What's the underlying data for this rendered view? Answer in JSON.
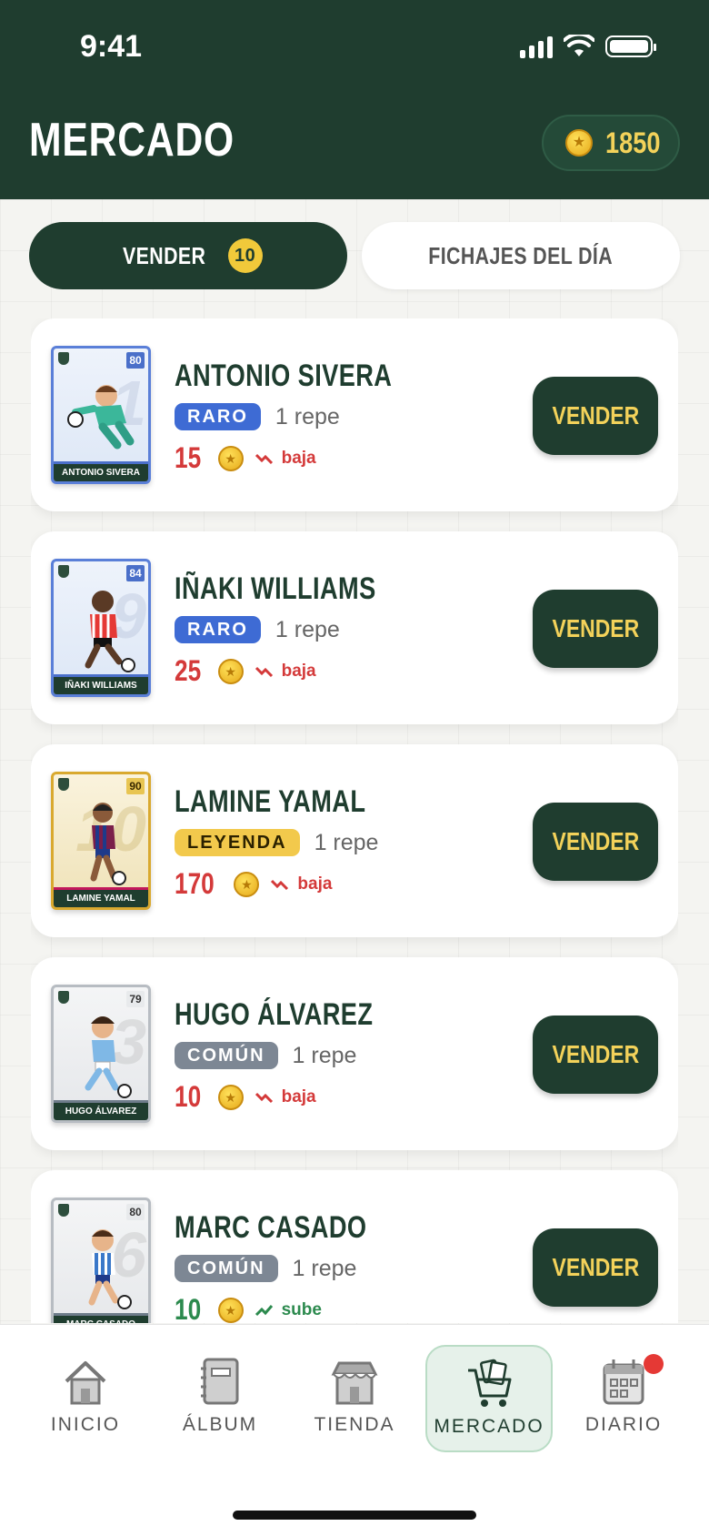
{
  "status_bar": {
    "time": "9:41"
  },
  "header": {
    "title": "MERCADO",
    "coins": "1850"
  },
  "tabs": [
    {
      "label": "VENDER",
      "badge": "10"
    },
    {
      "label": "FICHAJES DEL DÍA"
    }
  ],
  "players": [
    {
      "name": "ANTONIO SIVERA",
      "card_name": "ANTONIO SIVERA",
      "rating": "80",
      "number": "1",
      "rarity": "RARO",
      "repe": "1 repe",
      "price": "15",
      "trend": "baja",
      "action": "VENDER"
    },
    {
      "name": "IÑAKI WILLIAMS",
      "card_name": "IÑAKI WILLIAMS",
      "rating": "84",
      "number": "9",
      "rarity": "RARO",
      "repe": "1 repe",
      "price": "25",
      "trend": "baja",
      "action": "VENDER"
    },
    {
      "name": "LAMINE YAMAL",
      "card_name": "LAMINE YAMAL",
      "rating": "90",
      "number": "10",
      "rarity": "LEYENDA",
      "repe": "1 repe",
      "price": "170",
      "trend": "baja",
      "action": "VENDER"
    },
    {
      "name": "HUGO ÁLVAREZ",
      "card_name": "HUGO ÁLVAREZ",
      "rating": "79",
      "number": "3",
      "rarity": "COMÚN",
      "repe": "1 repe",
      "price": "10",
      "trend": "baja",
      "action": "VENDER"
    },
    {
      "name": "MARC CASADO",
      "card_name": "MARC CASADO",
      "rating": "80",
      "number": "6",
      "rarity": "COMÚN",
      "repe": "1 repe",
      "price": "10",
      "trend": "sube",
      "action": "VENDER"
    }
  ],
  "nav": [
    {
      "label": "INICIO",
      "icon": "house-icon"
    },
    {
      "label": "ÁLBUM",
      "icon": "album-icon"
    },
    {
      "label": "TIENDA",
      "icon": "shop-icon"
    },
    {
      "label": "MERCADO",
      "icon": "cart-cards-icon",
      "active": true
    },
    {
      "label": "DIARIO",
      "icon": "calendar-icon",
      "notification": true
    }
  ],
  "colors": {
    "header_bg": "#1f3d2f",
    "accent_yellow": "#f3d25a",
    "raro": "#3e6bd4",
    "leyenda": "#f2c94c",
    "comun": "#7d8794",
    "down": "#d43a3a",
    "up": "#2c8a4e"
  }
}
